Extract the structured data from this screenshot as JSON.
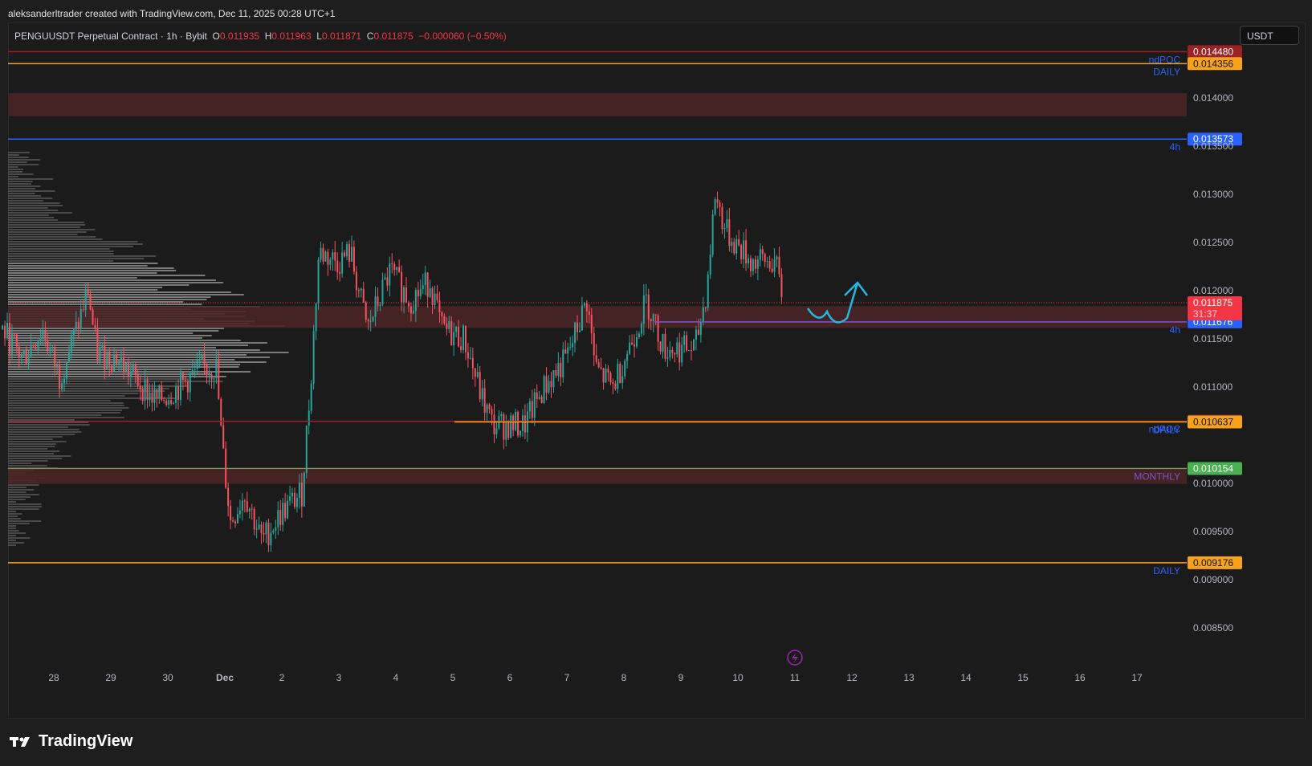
{
  "credit": "aleksanderltrader created with TradingView.com, Dec 11, 2025 00:28 UTC+1",
  "legend": {
    "symbol": "PENGUUSDT Perpetual Contract · 1h · Bybit",
    "o_label": "O",
    "o": "0.011935",
    "h_label": "H",
    "h": "0.011963",
    "l_label": "L",
    "l": "0.011871",
    "c_label": "C",
    "c": "0.011875",
    "change": "−0.000060 (−0.50%)"
  },
  "currency": "USDT",
  "brand": "TradingView",
  "colors": {
    "up": "#26a69a",
    "down": "#f7525f",
    "zone": "#4a2325"
  },
  "chart_data": {
    "type": "candlestick",
    "ylim": [
      0.0081,
      0.0146
    ],
    "y_ticks": [
      "0.014000",
      "0.013500",
      "0.013000",
      "0.012500",
      "0.012000",
      "0.011500",
      "0.011000",
      "0.010500",
      "0.010000",
      "0.009500",
      "0.009000",
      "0.008500"
    ],
    "y_tick_values": [
      0.014,
      0.0135,
      0.013,
      0.0125,
      0.012,
      0.0115,
      0.011,
      0.0105,
      0.01,
      0.0095,
      0.009,
      0.0085
    ],
    "x_ticks": [
      "28",
      "29",
      "30",
      "Dec",
      "2",
      "3",
      "4",
      "5",
      "6",
      "7",
      "8",
      "9",
      "10",
      "11",
      "12",
      "13",
      "14",
      "15",
      "16",
      "17"
    ],
    "x_tick_days": [
      1,
      2,
      3,
      4,
      5,
      6,
      7,
      8,
      9,
      10,
      11,
      12,
      13,
      14,
      15,
      16,
      17,
      18,
      19,
      20
    ],
    "price_path": [
      [
        0.1,
        0.0116
      ],
      [
        0.45,
        0.0113
      ],
      [
        0.8,
        0.0116
      ],
      [
        1.1,
        0.0111
      ],
      [
        1.4,
        0.0116
      ],
      [
        1.6,
        0.012
      ],
      [
        1.75,
        0.01135
      ],
      [
        2.1,
        0.0113
      ],
      [
        2.8,
        0.01085
      ],
      [
        3.2,
        0.011
      ],
      [
        3.6,
        0.0112
      ],
      [
        3.85,
        0.0112
      ],
      [
        3.95,
        0.0104
      ],
      [
        4.1,
        0.0096
      ],
      [
        4.35,
        0.0099
      ],
      [
        4.65,
        0.0094
      ],
      [
        5.0,
        0.0097
      ],
      [
        5.35,
        0.0099
      ],
      [
        5.5,
        0.011
      ],
      [
        5.65,
        0.0124
      ],
      [
        6.0,
        0.0123
      ],
      [
        6.2,
        0.0124
      ],
      [
        6.5,
        0.0116
      ],
      [
        6.9,
        0.0122
      ],
      [
        7.25,
        0.0119
      ],
      [
        7.6,
        0.0121
      ],
      [
        7.8,
        0.0116
      ],
      [
        8.2,
        0.0115
      ],
      [
        8.5,
        0.0109
      ],
      [
        8.7,
        0.0106
      ],
      [
        9.25,
        0.0106
      ],
      [
        9.6,
        0.011
      ],
      [
        10.0,
        0.0113
      ],
      [
        10.35,
        0.0119
      ],
      [
        10.5,
        0.0112
      ],
      [
        10.8,
        0.011
      ],
      [
        11.15,
        0.0115
      ],
      [
        11.4,
        0.0119
      ],
      [
        11.7,
        0.0114
      ],
      [
        12.25,
        0.0114
      ],
      [
        12.45,
        0.012
      ],
      [
        12.6,
        0.013
      ],
      [
        12.8,
        0.0126
      ],
      [
        13.25,
        0.0123
      ],
      [
        13.65,
        0.0123
      ],
      [
        13.8,
        0.011875
      ]
    ],
    "levels": [
      {
        "price": 0.01448,
        "color": "#9b2226",
        "label": "0.014480",
        "text": "",
        "extend": "full"
      },
      {
        "price": 0.014356,
        "color": "#f7a21b",
        "label": "0.014356",
        "text": "DAILY",
        "text2": "ndPOC",
        "extend": "full"
      },
      {
        "price": 0.013573,
        "color": "#2962ff",
        "label": "0.013573",
        "text": "4h",
        "extend": "full"
      },
      {
        "price": 0.011676,
        "color": "#7e57c2",
        "label": "0.011676",
        "text": "4h",
        "extend": "partial",
        "labelColor": "#2962ff"
      },
      {
        "price": 0.010645,
        "color": "#9b2226",
        "label": "0.010645",
        "text": "ndPOC",
        "extend": "full"
      },
      {
        "price": 0.010637,
        "color": "#f7a21b",
        "label": "0.010637",
        "text": "DAILY",
        "extend": "partial"
      },
      {
        "price": 0.010154,
        "color": "#8d8d5a",
        "label": "0.010154",
        "text": "MONTHLY",
        "extend": "full",
        "labelColor": "#4caf50",
        "textColor": "#7e57c2"
      },
      {
        "price": 0.009176,
        "color": "#f7a21b",
        "label": "0.009176",
        "text": "DAILY",
        "extend": "full"
      }
    ],
    "zones": [
      [
        0.01381,
        0.01405
      ],
      [
        0.011615,
        0.01184
      ],
      [
        0.009995,
        0.01014
      ]
    ],
    "last_price": {
      "price": 0.011875,
      "label": "0.011875",
      "countdown": "31:37"
    }
  }
}
